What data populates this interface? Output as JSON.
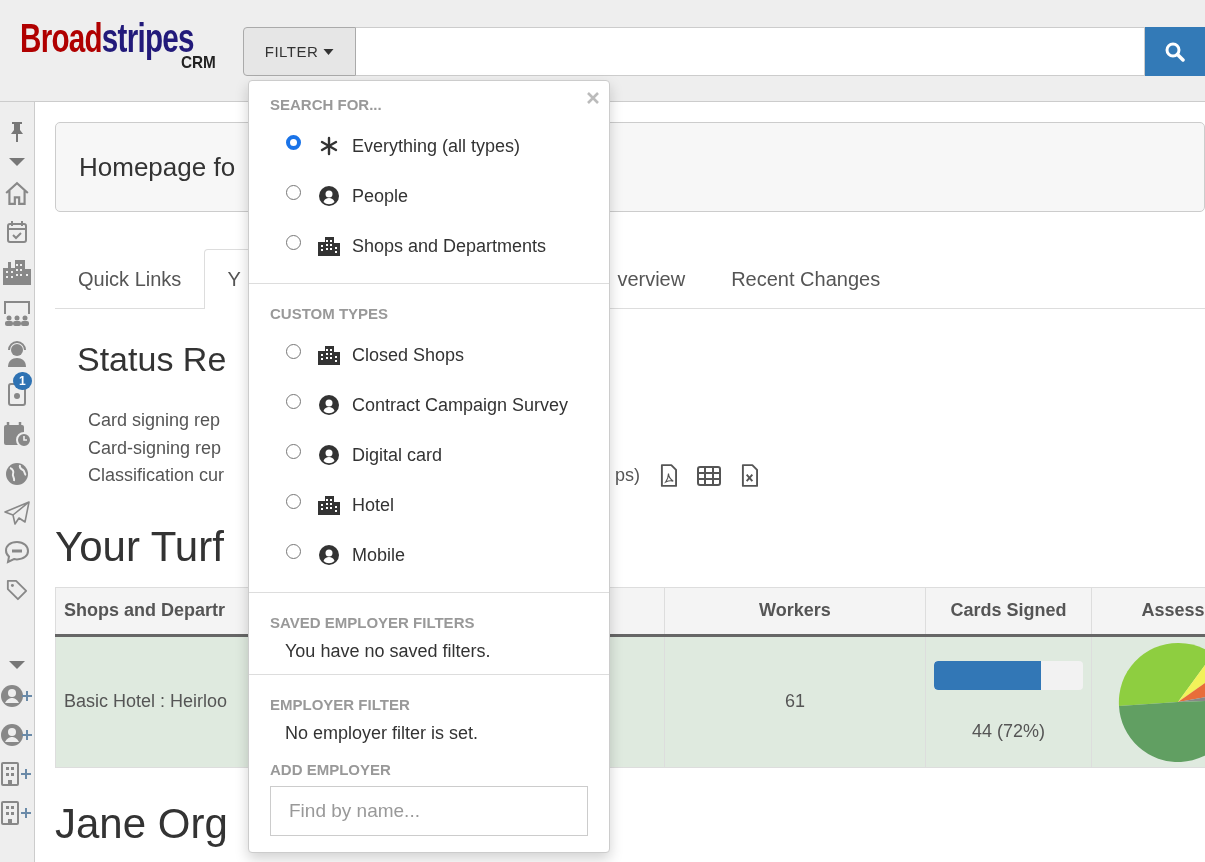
{
  "logo": {
    "brand_first": "Broad",
    "brand_second": "stripes",
    "product": "CRM"
  },
  "search": {
    "filter_label": "FILTER"
  },
  "sidebar": {
    "badge": "1"
  },
  "page_title": "Homepage fo",
  "tabs": [
    {
      "label": "Quick Links",
      "selected": false
    },
    {
      "label": "Y",
      "selected": true
    },
    {
      "label": "verview",
      "selected": false
    },
    {
      "label": "Recent Changes",
      "selected": false
    }
  ],
  "status_heading": "Status Re",
  "reports": [
    {
      "text": "Card signing rep"
    },
    {
      "text": "Card-signing rep"
    },
    {
      "text": "Classification cur",
      "tail": "ps)"
    }
  ],
  "turf_heading": "Your Turf",
  "table": {
    "columns": [
      "Shops and Departr",
      "Workers",
      "Cards Signed",
      "Assess"
    ],
    "rows": [
      {
        "name": "Basic Hotel : Heirloo",
        "workers": "61",
        "level": 0.72,
        "cards_reading": "44 (72%)"
      }
    ]
  },
  "person_heading": "Jane Org",
  "filter_menu": {
    "sections": [
      {
        "heading": "SEARCH FOR...",
        "options": [
          {
            "label": "Everything (all types)",
            "kind": "all",
            "selected": true
          },
          {
            "label": "People",
            "kind": "person",
            "selected": false
          },
          {
            "label": "Shops and Departments",
            "kind": "building",
            "selected": false
          }
        ]
      },
      {
        "heading": "CUSTOM TYPES",
        "options": [
          {
            "label": "Closed Shops",
            "kind": "building",
            "selected": false
          },
          {
            "label": "Contract Campaign Survey",
            "kind": "person",
            "selected": false
          },
          {
            "label": "Digital card",
            "kind": "person",
            "selected": false
          },
          {
            "label": "Hotel",
            "kind": "building",
            "selected": false
          },
          {
            "label": "Mobile",
            "kind": "person",
            "selected": false
          }
        ]
      },
      {
        "heading": "SAVED EMPLOYER FILTERS",
        "note": "You have no saved filters."
      }
    ],
    "employer_heading": "EMPLOYER FILTER",
    "employer_note": "No employer filter is set.",
    "add_heading": "ADD EMPLOYER",
    "add_placeholder": "Find by name..."
  }
}
